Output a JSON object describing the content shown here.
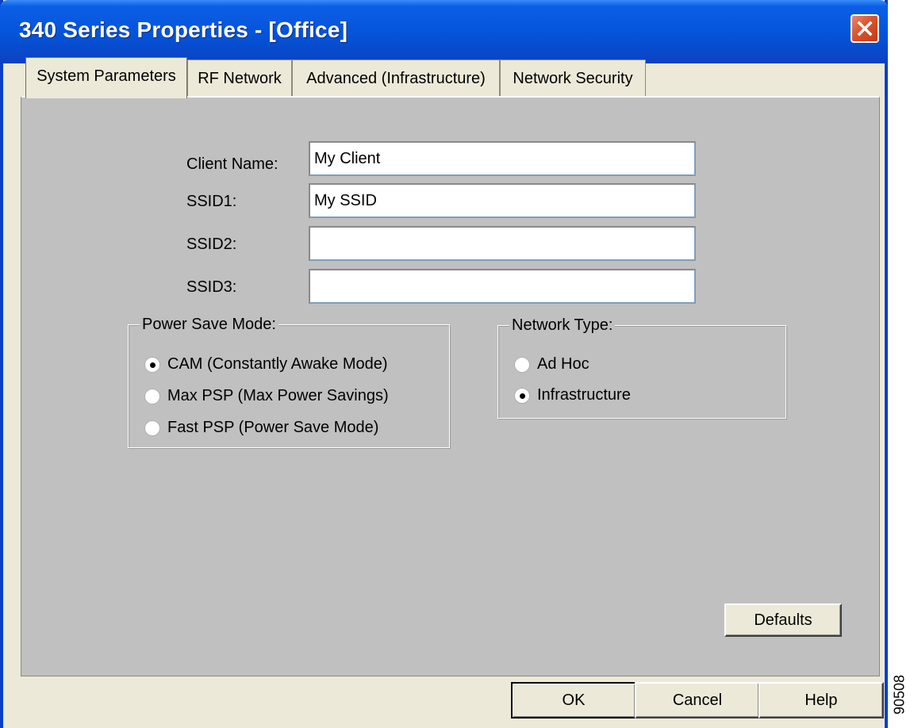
{
  "window": {
    "title": "340 Series Properties - [Office]",
    "close_icon": "close-icon",
    "close_color": "#d9542f",
    "title_color": "#0453d9"
  },
  "tabs": [
    {
      "label": "System Parameters",
      "active": true
    },
    {
      "label": "RF Network",
      "active": false
    },
    {
      "label": "Advanced (Infrastructure)",
      "active": false
    },
    {
      "label": "Network Security",
      "active": false
    }
  ],
  "fields": {
    "client_name": {
      "label": "Client Name:",
      "value": "My Client"
    },
    "ssid1": {
      "label": "SSID1:",
      "value": "My SSID"
    },
    "ssid2": {
      "label": "SSID2:",
      "value": ""
    },
    "ssid3": {
      "label": "SSID3:",
      "value": ""
    }
  },
  "power_save": {
    "title": "Power Save Mode:",
    "options": [
      {
        "label": "CAM (Constantly Awake Mode)",
        "selected": true
      },
      {
        "label": "Max PSP (Max Power Savings)",
        "selected": false
      },
      {
        "label": "Fast PSP (Power Save Mode)",
        "selected": false
      }
    ]
  },
  "network_type": {
    "title": "Network Type:",
    "options": [
      {
        "label": "Ad Hoc",
        "selected": false
      },
      {
        "label": "Infrastructure",
        "selected": true
      }
    ]
  },
  "buttons": {
    "defaults": "Defaults",
    "ok": "OK",
    "cancel": "Cancel",
    "help": "Help"
  },
  "figure_id": "90508",
  "colors": {
    "panel_bg": "#c0c0c0",
    "dialog_bg": "#ece9d8",
    "titlebar": "#0453d9"
  }
}
